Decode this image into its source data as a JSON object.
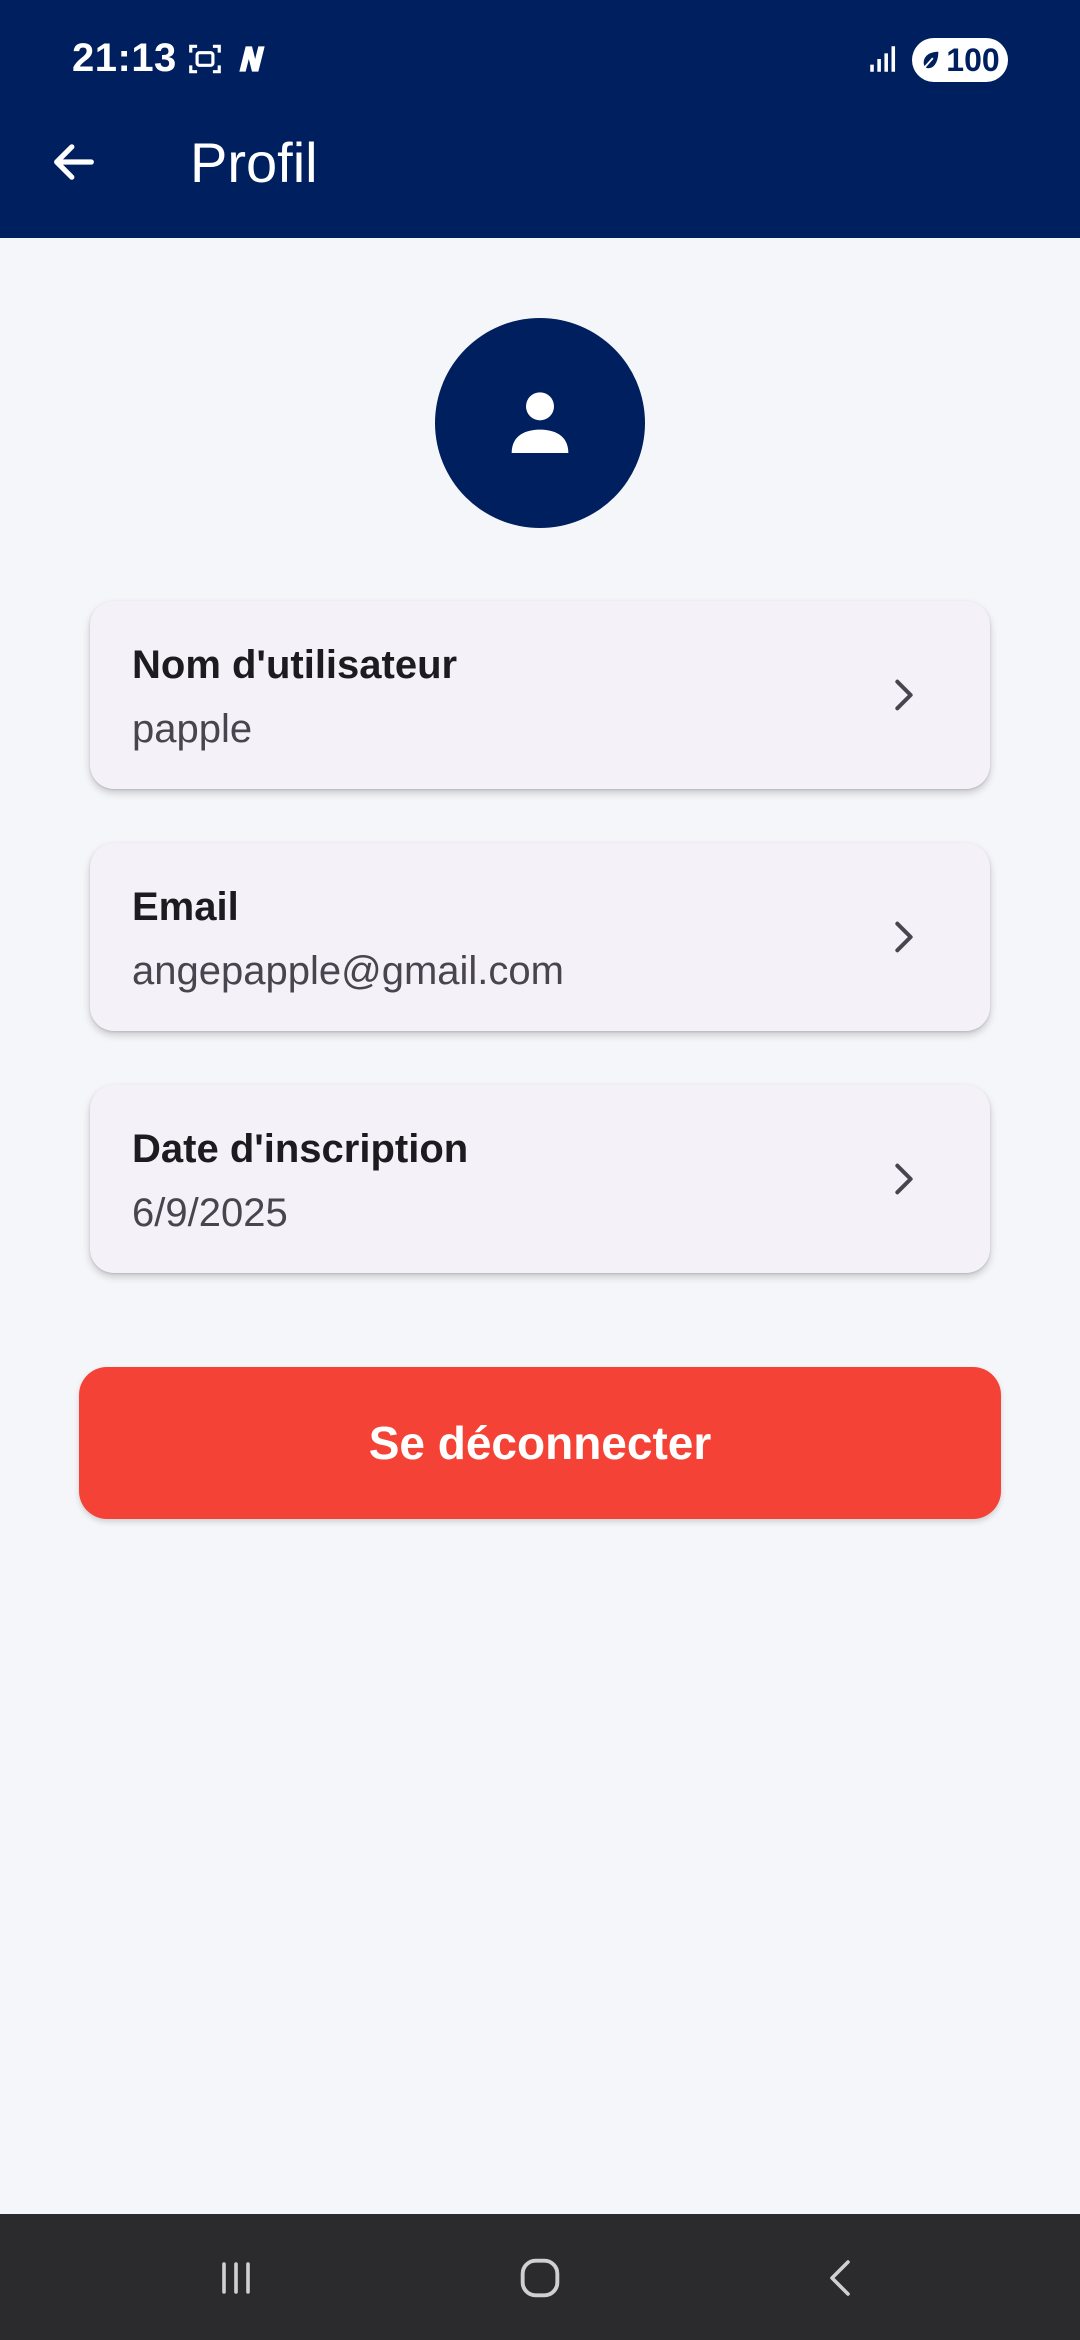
{
  "status_bar": {
    "time": "21:13",
    "battery": "100",
    "icons": [
      "screenshot-icon",
      "n-app-icon",
      "signal-icon",
      "battery-saver-icon"
    ]
  },
  "app_bar": {
    "title": "Profil",
    "back_icon": "arrow-left-icon"
  },
  "colors": {
    "primary": "#001f5e",
    "logout": "#f44336",
    "background": "#f5f6fa",
    "card": "#f4f1f8"
  },
  "profile": {
    "avatar_icon": "person-icon",
    "items": [
      {
        "label": "Nom d'utilisateur",
        "value": "papple"
      },
      {
        "label": "Email",
        "value": "angepapple@gmail.com"
      },
      {
        "label": "Date d'inscription",
        "value": "6/9/2025"
      }
    ]
  },
  "logout_label": "Se déconnecter",
  "nav_bar": {
    "icons": [
      "recents-icon",
      "home-icon",
      "back-icon"
    ]
  }
}
